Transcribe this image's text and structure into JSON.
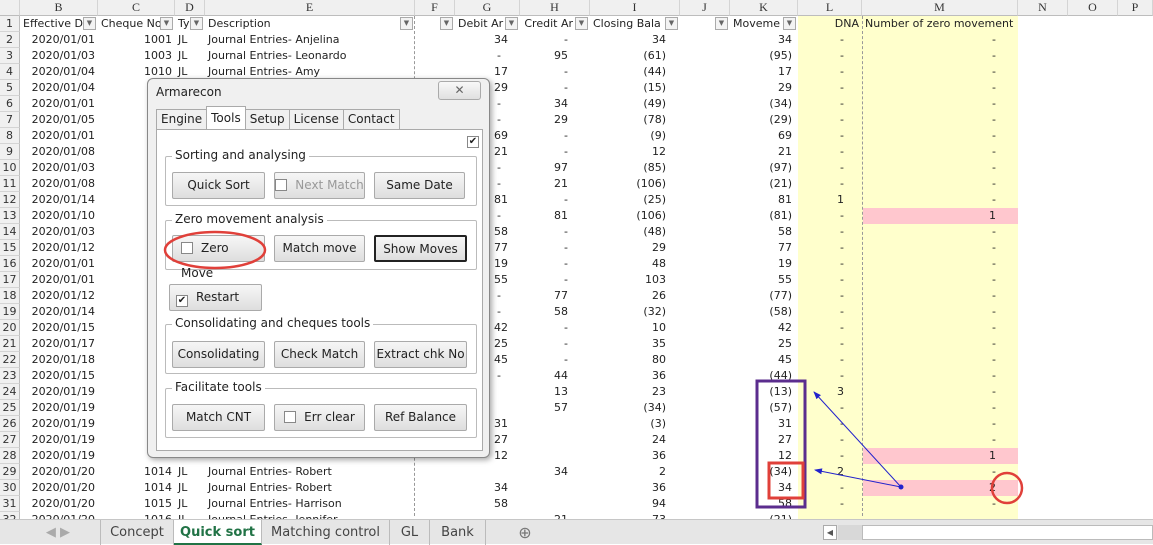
{
  "columns": [
    "B",
    "C",
    "D",
    "E",
    "F",
    "G",
    "H",
    "I",
    "J",
    "K",
    "L",
    "M",
    "N",
    "O",
    "P"
  ],
  "headers": {
    "B": "Effective D",
    "C": "Cheque No",
    "D": "Ty",
    "E": "Description",
    "G": "Debit Ar",
    "H": "Credit Ar",
    "I": "Closing Bala",
    "K": "Moveme",
    "L": "DNA",
    "M": "Number of zero movement"
  },
  "rows": [
    {
      "n": "1"
    },
    {
      "n": "2",
      "B": "2020/01/01",
      "C": "1001",
      "D": "JL",
      "E": "Journal Entries- Anjelina",
      "G": "34",
      "H": "-",
      "I": "34",
      "K": "34",
      "L": "-",
      "M": "-"
    },
    {
      "n": "3",
      "B": "2020/01/03",
      "C": "1003",
      "D": "JL",
      "E": "Journal Entries- Leonardo",
      "G": "-",
      "H": "95",
      "I": "(61)",
      "K": "(95)",
      "L": "-",
      "M": "-"
    },
    {
      "n": "4",
      "B": "2020/01/04",
      "C": "1010",
      "D": "JL",
      "E": "Journal Entries-  Amy",
      "G": "17",
      "H": "-",
      "I": "(44)",
      "K": "17",
      "L": "-",
      "M": "-"
    },
    {
      "n": "5",
      "B": "2020/01/04",
      "G": "29",
      "H": "-",
      "I": "(15)",
      "K": "29",
      "L": "-",
      "M": "-"
    },
    {
      "n": "6",
      "B": "2020/01/01",
      "G": "-",
      "H": "34",
      "I": "(49)",
      "K": "(34)",
      "L": "-",
      "M": "-"
    },
    {
      "n": "7",
      "B": "2020/01/05",
      "G": "-",
      "H": "29",
      "I": "(78)",
      "K": "(29)",
      "L": "-",
      "M": "-"
    },
    {
      "n": "8",
      "B": "2020/01/01",
      "G": "69",
      "H": "-",
      "I": "(9)",
      "K": "69",
      "L": "-",
      "M": "-"
    },
    {
      "n": "9",
      "B": "2020/01/08",
      "G": "21",
      "H": "-",
      "I": "12",
      "K": "21",
      "L": "-",
      "M": "-"
    },
    {
      "n": "10",
      "B": "2020/01/03",
      "G": "-",
      "H": "97",
      "I": "(85)",
      "K": "(97)",
      "L": "-",
      "M": "-"
    },
    {
      "n": "11",
      "B": "2020/01/08",
      "G": "-",
      "H": "21",
      "I": "(106)",
      "K": "(21)",
      "L": "-",
      "M": "-"
    },
    {
      "n": "12",
      "B": "2020/01/14",
      "G": "81",
      "H": "-",
      "I": "(25)",
      "K": "81",
      "L": "1",
      "M": "-"
    },
    {
      "n": "13",
      "B": "2020/01/10",
      "G": "-",
      "H": "81",
      "I": "(106)",
      "K": "(81)",
      "L": "-",
      "M": "1",
      "hl": true
    },
    {
      "n": "14",
      "B": "2020/01/03",
      "G": "58",
      "H": "-",
      "I": "(48)",
      "K": "58",
      "L": "-",
      "M": "-"
    },
    {
      "n": "15",
      "B": "2020/01/12",
      "G": "77",
      "H": "-",
      "I": "29",
      "K": "77",
      "L": "-",
      "M": "-"
    },
    {
      "n": "16",
      "B": "2020/01/01",
      "G": "19",
      "H": "-",
      "I": "48",
      "K": "19",
      "L": "-",
      "M": "-"
    },
    {
      "n": "17",
      "B": "2020/01/01",
      "G": "55",
      "H": "-",
      "I": "103",
      "K": "55",
      "L": "-",
      "M": "-"
    },
    {
      "n": "18",
      "B": "2020/01/12",
      "G": "-",
      "H": "77",
      "I": "26",
      "K": "(77)",
      "L": "-",
      "M": "-"
    },
    {
      "n": "19",
      "B": "2020/01/14",
      "G": "-",
      "H": "58",
      "I": "(32)",
      "K": "(58)",
      "L": "-",
      "M": "-"
    },
    {
      "n": "20",
      "B": "2020/01/15",
      "G": "42",
      "H": "-",
      "I": "10",
      "K": "42",
      "L": "-",
      "M": "-"
    },
    {
      "n": "21",
      "B": "2020/01/17",
      "G": "25",
      "H": "-",
      "I": "35",
      "K": "25",
      "L": "-",
      "M": "-"
    },
    {
      "n": "22",
      "B": "2020/01/18",
      "G": "45",
      "H": "-",
      "I": "80",
      "K": "45",
      "L": "-",
      "M": "-"
    },
    {
      "n": "23",
      "B": "2020/01/15",
      "G": "-",
      "H": "44",
      "I": "36",
      "K": "(44)",
      "L": "-",
      "M": "-"
    },
    {
      "n": "24",
      "B": "2020/01/19",
      "H": "13",
      "I": "23",
      "K": "(13)",
      "L": "3",
      "M": "-"
    },
    {
      "n": "25",
      "B": "2020/01/19",
      "H": "57",
      "I": "(34)",
      "K": "(57)",
      "L": "-",
      "M": "-"
    },
    {
      "n": "26",
      "B": "2020/01/19",
      "G": "31",
      "I": "(3)",
      "K": "31",
      "L": "-",
      "M": "-"
    },
    {
      "n": "27",
      "B": "2020/01/19",
      "G": "27",
      "I": "24",
      "K": "27",
      "L": "-",
      "M": "-"
    },
    {
      "n": "28",
      "B": "2020/01/19",
      "G": "12",
      "I": "36",
      "K": "12",
      "L": "-",
      "M": "1",
      "hl": true
    },
    {
      "n": "29",
      "B": "2020/01/20",
      "C": "1014",
      "D": "JL",
      "E": "Journal Entries-  Robert",
      "H": "34",
      "I": "2",
      "K": "(34)",
      "L": "2",
      "M": "-"
    },
    {
      "n": "30",
      "B": "2020/01/20",
      "C": "1014",
      "D": "JL",
      "E": "Journal Entries-  Robert",
      "G": "34",
      "I": "36",
      "K": "34",
      "L": "-",
      "M": "2",
      "hl": true
    },
    {
      "n": "31",
      "B": "2020/01/20",
      "C": "1015",
      "D": "JL",
      "E": "Journal Entries-  Harrison",
      "G": "58",
      "I": "94",
      "K": "58",
      "L": "-",
      "M": "-"
    },
    {
      "n": "32",
      "B": "2020/01/20",
      "C": "1016",
      "D": "JL",
      "E": "Journal Entries-  Jennifer",
      "H": "21",
      "I": "73",
      "K": "(21)"
    }
  ],
  "dialog": {
    "title": "Armarecon",
    "close": "✕",
    "tabs": [
      "Engine",
      "Tools",
      "Setup",
      "License",
      "Contact"
    ],
    "active_tab": "Tools",
    "top_checkbox_checked": true,
    "groups": {
      "sorting": {
        "label": "Sorting and analysing",
        "quick_sort": "Quick Sort",
        "next_match": "Next Match",
        "same_date": "Same Date"
      },
      "zero": {
        "label": "Zero movement analysis",
        "zero_move": "Zero Move",
        "match_move": "Match move",
        "show_moves": "Show Moves"
      },
      "restart": "Restart",
      "consol": {
        "label": "Consolidating and cheques tools",
        "consolidating": "Consolidating",
        "check_match": "Check Match",
        "extract": "Extract chk No"
      },
      "facilitate": {
        "label": "Facilitate tools",
        "match_cnt": "Match CNT",
        "err_clear": "Err clear",
        "ref_balance": "Ref Balance"
      }
    }
  },
  "sheet_tabs": [
    "Concept",
    "Quick sort",
    "Matching control",
    "GL",
    "Bank"
  ],
  "active_sheet": "Quick sort",
  "check": "✔",
  "colors": {
    "highlight": "#ffffcc",
    "zero_move_pink": "#ffc7ce",
    "annotation_red": "#e0403a",
    "annotation_purple": "#5b2d8e",
    "arrow_blue": "#2222cc",
    "excel_green": "#217346"
  }
}
